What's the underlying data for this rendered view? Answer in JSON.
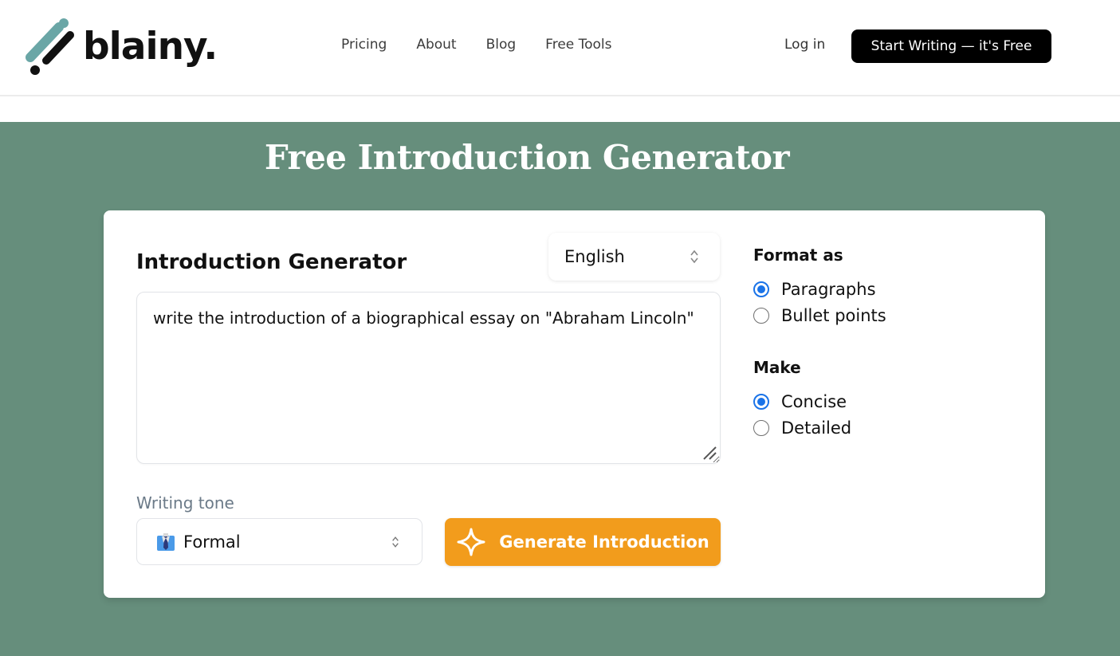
{
  "header": {
    "logo_text": "blainy.",
    "nav": [
      "Pricing",
      "About",
      "Blog",
      "Free Tools"
    ],
    "login_label": "Log in",
    "cta_label": "Start Writing — it's Free"
  },
  "hero": {
    "title": "Free Introduction Generator"
  },
  "card": {
    "title": "Introduction Generator",
    "language": {
      "selected": "English"
    },
    "prompt": {
      "value": "write the introduction of a biographical essay on \"Abraham Lincoln\""
    },
    "tone": {
      "label": "Writing tone",
      "icon": "business-shirt-icon",
      "selected": "Formal"
    },
    "generate_label": "Generate Introduction",
    "format": {
      "title": "Format as",
      "options": [
        {
          "label": "Paragraphs",
          "checked": true
        },
        {
          "label": "Bullet points",
          "checked": false
        }
      ]
    },
    "make": {
      "title": "Make",
      "options": [
        {
          "label": "Concise",
          "checked": true
        },
        {
          "label": "Detailed",
          "checked": false
        }
      ]
    }
  },
  "colors": {
    "hero_bg": "#668e7c",
    "accent_orange": "#f29c1c",
    "radio_blue": "#1a73e8",
    "logo_teal": "#6aa6a6"
  }
}
